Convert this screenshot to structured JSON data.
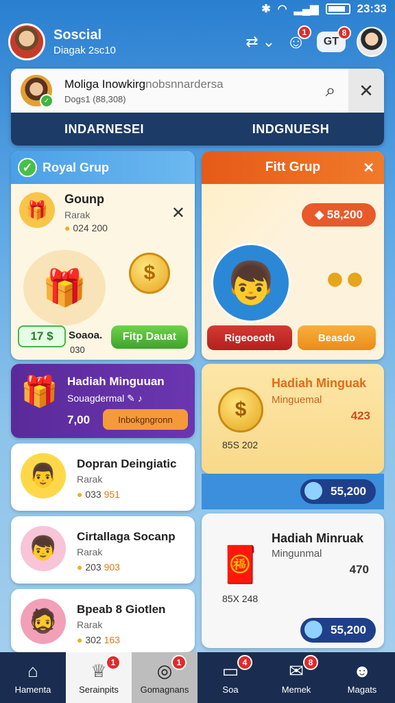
{
  "status": {
    "time": "23:33"
  },
  "header": {
    "title": "Soscial",
    "subtitle": "Diagak 2sc10",
    "notif_badge": "1",
    "chip_label": "GT",
    "chip_badge": "8"
  },
  "search": {
    "title_main": "Moliga Inowkirg",
    "title_muted": "nobsnnardersa",
    "subtitle": "Dogs1 (88,308)"
  },
  "tabs": [
    {
      "label": "INDARNESEI"
    },
    {
      "label": "INDGNUESH"
    }
  ],
  "royal": {
    "header": "Royal Grup",
    "title": "Gounp",
    "sub": "Rarak",
    "meta": "024 200",
    "gift_label": "Siajo Soaoa.",
    "gift_value": "030",
    "score": "17",
    "button": "Fitp Dauat"
  },
  "fitt": {
    "header": "Fitt Grup",
    "price": "58,200",
    "btn_red": "Rigeoeoth",
    "btn_orange": "Beasdo"
  },
  "purple_card": {
    "title": "Hadiah Minguuan",
    "sub": "Souagdermal",
    "value": "7,00",
    "button": "Inbokgngronn"
  },
  "yellow_card": {
    "title": "Hadiah Minguak",
    "sub": "Minguemal",
    "value": "423",
    "meta": "85S 202",
    "pill": "55,200"
  },
  "list_items": [
    {
      "title": "Dopran Deingiatic",
      "sub": "Rarak",
      "meta_a": "033",
      "meta_b": "951"
    },
    {
      "title": "Cirtallaga Socanp",
      "sub": "Rarak",
      "meta_a": "203",
      "meta_b": "903"
    },
    {
      "title": "Bpeab 8 Giotlen",
      "sub": "Rarak",
      "meta_a": "302",
      "meta_b": "163"
    }
  ],
  "white_card": {
    "title": "Hadiah Minruak",
    "sub": "Mingunmal",
    "value": "470",
    "meta": "85X 248",
    "pill": "55,200"
  },
  "nav": [
    {
      "label": "Hamenta",
      "badge": ""
    },
    {
      "label": "Serainpits",
      "badge": "1"
    },
    {
      "label": "Gomagnans",
      "badge": "1"
    },
    {
      "label": "Soa",
      "badge": "4"
    },
    {
      "label": "Memek",
      "badge": "8"
    },
    {
      "label": "Magats",
      "badge": ""
    }
  ]
}
